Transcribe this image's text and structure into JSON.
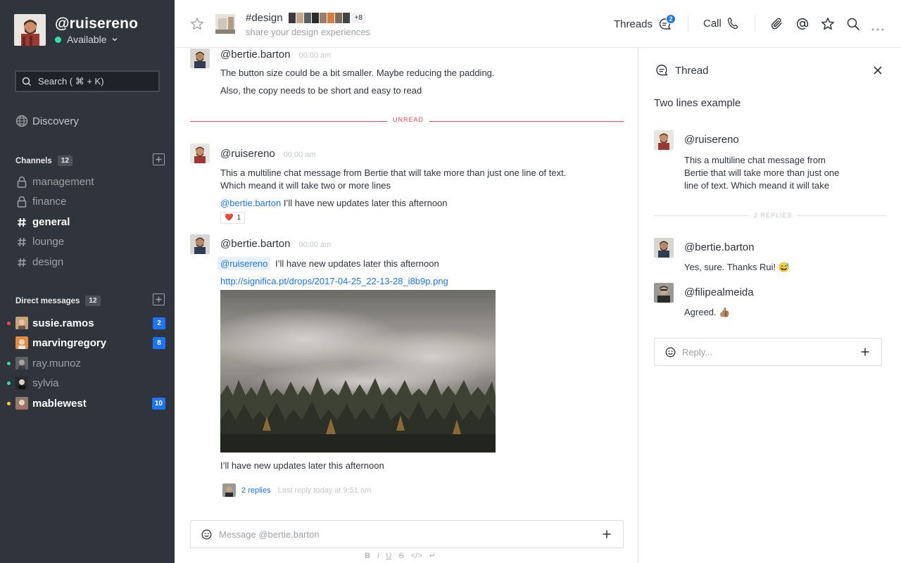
{
  "user": {
    "name": "@ruisereno",
    "status": "Available"
  },
  "search": {
    "placeholder": "Search ( ⌘ + K)"
  },
  "nav": {
    "discovery": "Discovery"
  },
  "channels": {
    "label": "Channels",
    "count": "12",
    "items": [
      {
        "name": "management",
        "icon": "lock-icon"
      },
      {
        "name": "finance",
        "icon": "lock-icon"
      },
      {
        "name": "general",
        "icon": "hash-icon"
      },
      {
        "name": "lounge",
        "icon": "hash-icon"
      },
      {
        "name": "design",
        "icon": "hash-icon"
      }
    ]
  },
  "direct_messages": {
    "label": "Direct messages",
    "count": "12",
    "items": [
      {
        "name": "susie.ramos",
        "badge": "2",
        "status_color": "#f5455c"
      },
      {
        "name": "marvingregory",
        "badge": "8",
        "status_color": "#2f343d"
      },
      {
        "name": "ray.munoz",
        "badge": "",
        "status_color": "#2de0a5"
      },
      {
        "name": "sylvia",
        "badge": "",
        "status_color": "#2de0a5"
      },
      {
        "name": "mablewest",
        "badge": "10",
        "status_color": "#ffd21f"
      }
    ]
  },
  "header": {
    "channel_name": "#design",
    "extra_members": "+8",
    "topic": "share your design experiences",
    "threads_label": "Threads",
    "threads_badge": "2",
    "call_label": "Call"
  },
  "messages": [
    {
      "author": "@bertie.barton",
      "time": "00:00 am",
      "lines": [
        "The button size could be a bit smaller. Maybe reducing the padding.",
        "Also, the copy needs to be short and easy to read"
      ]
    },
    {
      "author": "@ruisereno",
      "time": "00:00 am",
      "text1": "This a multiline chat message from Bertie that will take more than just one line of text.",
      "text2": "Which meand it will take two or more lines",
      "mention": "@bertie.barton",
      "mention_text": " I’ll have new updates later this afternoon",
      "reaction_emoji": "❤️",
      "reaction_count": "1"
    },
    {
      "author": "@bertie.barton",
      "time": "00:00 am",
      "mention": "@ruisereno",
      "mention_text": "I’ll have new updates later this afternoon",
      "link": "http://significa.pt/drops/2017-04-25_22-13-28_i8b9p.png",
      "after_image": "I’ll have new updates later this afternoon",
      "replies_count": "2 replies",
      "last_reply": "Last reply today at 9:51 am"
    }
  ],
  "unread_label": "UNREAD",
  "composer": {
    "placeholder": "Message @bertie.barton"
  },
  "format_toolbar": [
    "B",
    "i",
    "U",
    "S",
    "</>",
    "↵"
  ],
  "thread": {
    "title": "Thread",
    "heading": "Two lines example",
    "root": {
      "author": "@ruisereno",
      "lines": [
        "This a multiline chat message from",
        "Bertie that will take more than just one",
        "line of text. Which meand it will take"
      ]
    },
    "replies_label": "2 REPLIES",
    "replies": [
      {
        "author": "@bertie.barton",
        "text": "Yes, sure. Thanks Rui!  😅"
      },
      {
        "author": "@filipealmeida",
        "text": "Agreed. 👍🏽"
      }
    ],
    "reply_placeholder": "Reply..."
  },
  "colors": {
    "accent": "#1d74f5",
    "unread": "#f5455c",
    "sidebar": "#2f343d",
    "online": "#2de0a5"
  }
}
